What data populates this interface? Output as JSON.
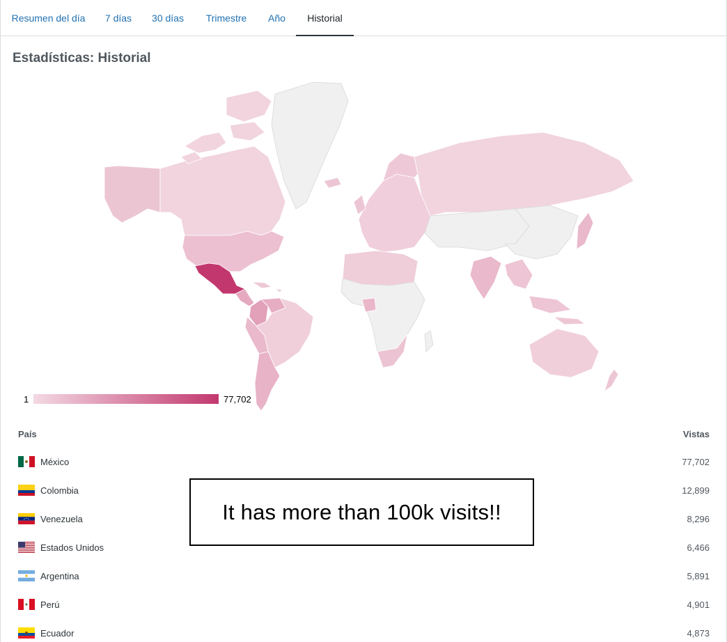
{
  "tabs": [
    {
      "label": "Resumen del día",
      "active": false
    },
    {
      "label": "7 días",
      "active": false
    },
    {
      "label": "30 días",
      "active": false
    },
    {
      "label": "Trimestre",
      "active": false
    },
    {
      "label": "Año",
      "active": false
    },
    {
      "label": "Historial",
      "active": true
    }
  ],
  "page_title": "Estadísticas: Historial",
  "map": {
    "legend_min": "1",
    "legend_max": "77,702",
    "colors": {
      "low": "#f3d9e3",
      "high": "#c2386e",
      "no_data": "#f2f2f2"
    }
  },
  "table": {
    "header_country": "País",
    "header_views": "Vistas",
    "rows": [
      {
        "country": "México",
        "views": "77,702",
        "flag": "mx-flag-icon"
      },
      {
        "country": "Colombia",
        "views": "12,899",
        "flag": "co-flag-icon"
      },
      {
        "country": "Venezuela",
        "views": "8,296",
        "flag": "ve-flag-icon"
      },
      {
        "country": "Estados Unidos",
        "views": "6,466",
        "flag": "us-flag-icon"
      },
      {
        "country": "Argentina",
        "views": "5,891",
        "flag": "ar-flag-icon"
      },
      {
        "country": "Perú",
        "views": "4,901",
        "flag": "pe-flag-icon"
      },
      {
        "country": "Ecuador",
        "views": "4,873",
        "flag": "ec-flag-icon"
      }
    ]
  },
  "annotation": "It has more than 100k visits!!"
}
